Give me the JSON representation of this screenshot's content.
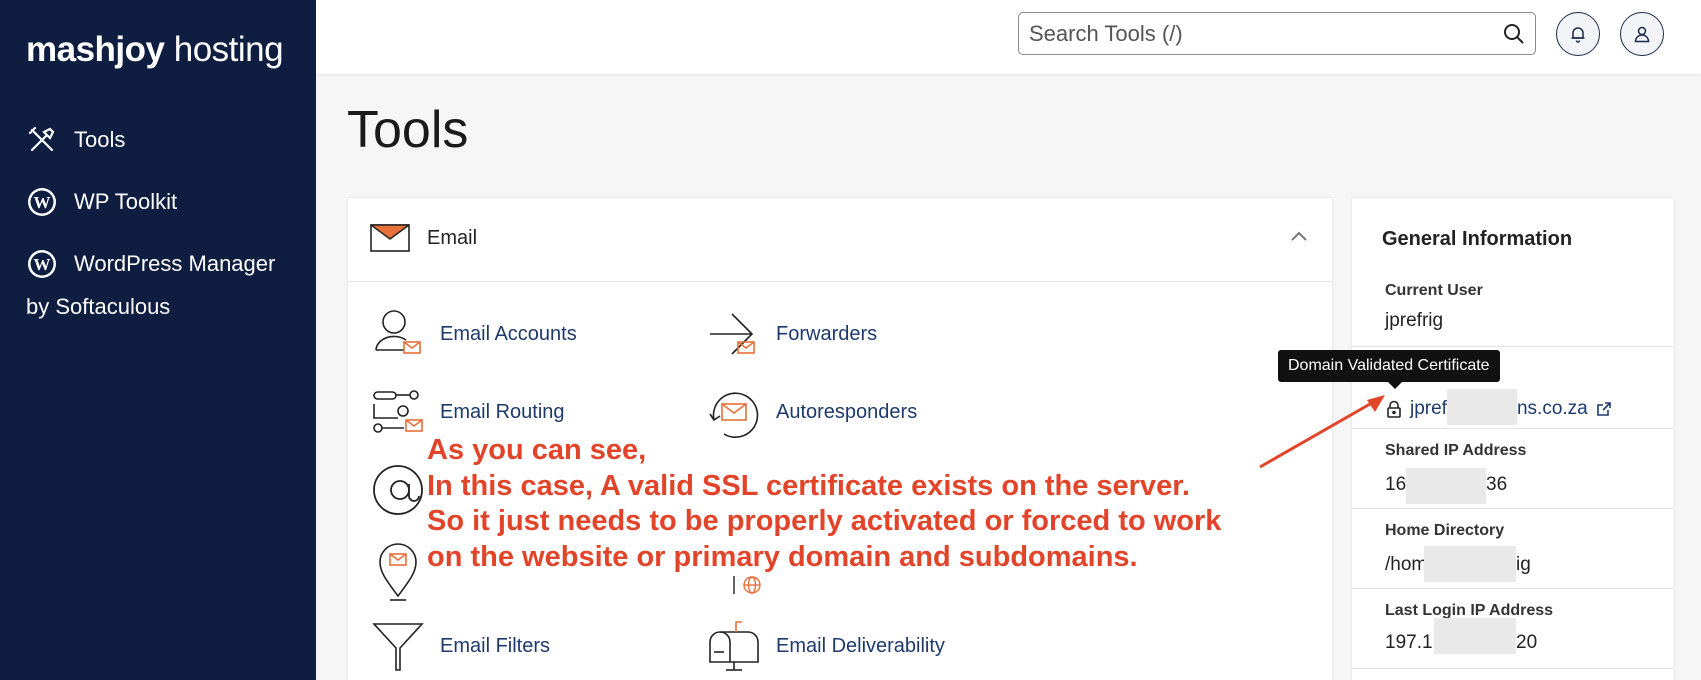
{
  "brand": {
    "name_bold": "mashjoy",
    "name_light": " hosting"
  },
  "sidebar": {
    "items": [
      {
        "label": "Tools"
      },
      {
        "label": "WP Toolkit"
      },
      {
        "label": "WordPress Manager",
        "label_line2": "by Softaculous"
      }
    ]
  },
  "search": {
    "placeholder": "Search Tools (/)"
  },
  "page": {
    "title": "Tools"
  },
  "email_section": {
    "title": "Email",
    "tools": [
      {
        "label": "Email Accounts"
      },
      {
        "label": "Forwarders"
      },
      {
        "label": "Email Routing"
      },
      {
        "label": "Autoresponders"
      },
      {
        "label": "Email Filters"
      },
      {
        "label": "Email Deliverability"
      }
    ]
  },
  "general_info": {
    "title": "General Information",
    "current_user_label": "Current User",
    "current_user": "jprefrig",
    "domain_partial_start": "jpref",
    "domain_partial_end": "ns.co.za",
    "shared_ip_label": "Shared IP Address",
    "shared_ip_start": "16",
    "shared_ip_end": "36",
    "home_dir_label": "Home Directory",
    "home_dir_start": "/hom",
    "home_dir_end": "ig",
    "last_login_label": "Last Login IP Address",
    "last_login_start": "197.1",
    "last_login_end": "20"
  },
  "tooltip": {
    "text": "Domain Validated Certificate"
  },
  "annotation": {
    "lines": [
      "As you can see,",
      "In this case, A valid SSL certificate exists on the server.",
      "So it just needs to be properly activated or forced to work",
      "on the website or primary domain and subdomains."
    ]
  },
  "colors": {
    "sidebar_bg": "#0e1d40",
    "link": "#1e3a6d",
    "accent": "#e8703a",
    "annotation": "#e2442a"
  }
}
